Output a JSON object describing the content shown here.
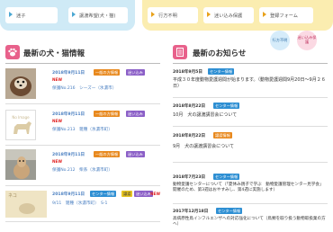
{
  "nav": {
    "left": [
      "迷子",
      "譲渡希望(犬・猫)"
    ],
    "right": [
      "行方不明",
      "迷い込み保護",
      "登録フォーム"
    ]
  },
  "tags": {
    "missing": "行方不明",
    "stray": "迷い込み保護"
  },
  "pets": {
    "title": "最新の犬・猫情報",
    "items": [
      {
        "date": "2018年9月11日",
        "badges": [
          "一般の方情報",
          "迷い込み"
        ],
        "new": "NEW",
        "text": "保護No.216　シーズー（氷濃市）"
      },
      {
        "date": "2018年9月11日",
        "badges": [
          "一般の方情報",
          "迷い込み"
        ],
        "new": "NEW",
        "text": "保護No.213　雑種（氷濃市町）",
        "noimage": "No Image"
      },
      {
        "date": "2018年9月11日",
        "badges": [
          "一般の方情報",
          "迷い込み"
        ],
        "new": "NEW",
        "text": "保護No.212　柴系（氷濃市町）"
      },
      {
        "date": "2018年9月11日",
        "badges": [
          "センター情報",
          "譲渡",
          "迷い込み"
        ],
        "new": "NEW",
        "text": "9/11　雑種（氷濃市町）　S-1",
        "thumbtext": "ネコ"
      }
    ]
  },
  "news": {
    "title": "最新のお知らせ",
    "items": [
      {
        "date": "2018年9月5日",
        "badge": "センター情報",
        "text": "平成３０年度動物愛護週間が始まります。（動物愛護週間9月20日～9月２６日）"
      },
      {
        "date": "2018年8月22日",
        "badge": "センター情報",
        "text": "10月　犬の譲渡講習会について"
      },
      {
        "date": "2018年8月22日",
        "badge": "譲渡情報",
        "text": "9月　犬の譲渡講習会について"
      },
      {
        "date": "2018年7月23日",
        "badge": "センター情報",
        "text": "動物愛護センターについて（「夏休み親子で学ぶ　動物愛護管理センター見学会」開催のため、第3週はおやすみし、第4週に実施します）"
      },
      {
        "date": "2017年12月18日",
        "badge": "センター情報",
        "text": "高病原性鳥インフルエンザへの対応強化について（鳥類を取り扱う動物取扱業の方へ）"
      }
    ]
  },
  "colors": {
    "orange": "#e8891e",
    "purple": "#8b5fc7",
    "blue": "#2e8fd3",
    "pink": "#e8618b"
  }
}
